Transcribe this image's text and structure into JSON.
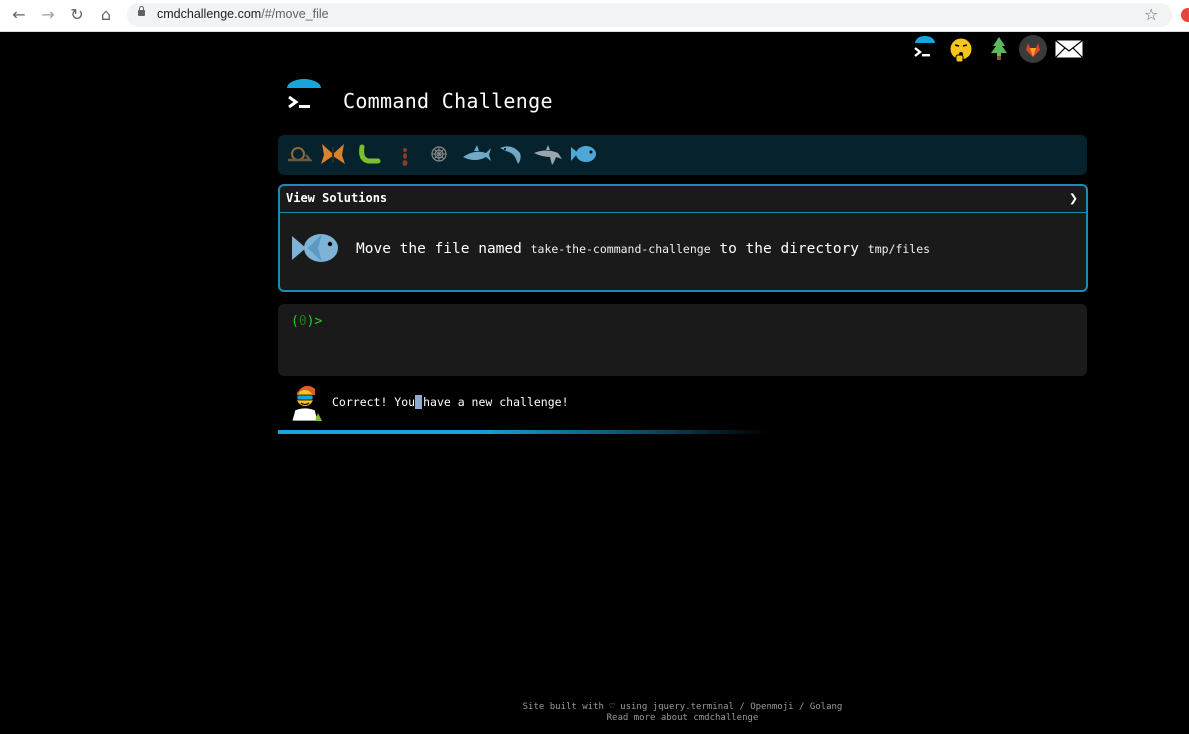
{
  "browser": {
    "back_icon": "arrow-left-icon",
    "forward_icon": "arrow-right-icon",
    "reload_icon": "reload-icon",
    "home_icon": "home-icon",
    "url_host": "cmdchallenge.com",
    "url_path": "/#/move_file",
    "bookmark_icon": "star-icon"
  },
  "header": {
    "title": "Command Challenge"
  },
  "top_icons": [
    "terminal-logo-icon",
    "secret-face-icon",
    "tree-icon",
    "gitlab-icon",
    "mail-icon"
  ],
  "badges": [
    "snail",
    "butterfly",
    "caterpillar",
    "ant",
    "spider-web",
    "shark",
    "dolphin",
    "dolphin-2",
    "fish"
  ],
  "challenge": {
    "view_solutions_label": "View Solutions",
    "chevron": "❯",
    "text_before": "Move the file named ",
    "file_name": "take-the-command-challenge",
    "text_middle": " to the directory ",
    "dir_name": "tmp/files"
  },
  "terminal": {
    "prompt_open": "(",
    "prompt_num": "0",
    "prompt_close": ")>"
  },
  "status": {
    "text_before": "Correct! You",
    "text_after": "have a new challenge!",
    "progress_fraction": 0.4
  },
  "footer": {
    "line1": "Site built with ♡ using jquery.terminal / Openmoji / Golang",
    "line2": "Read more about cmdchallenge"
  },
  "colors": {
    "accent": "#1e8ab1",
    "prompt_green": "#2ecc1f",
    "badge_bar": "#06222c"
  }
}
